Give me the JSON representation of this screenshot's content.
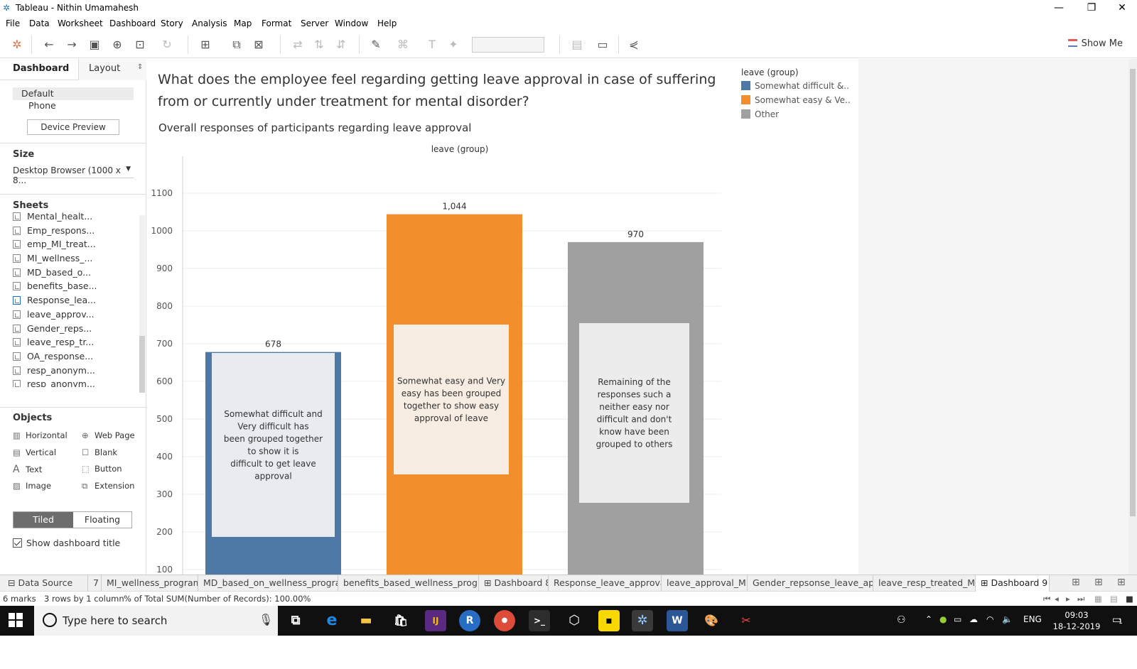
{
  "window": {
    "title": "Tableau - Nithin Umamahesh"
  },
  "menu": [
    "File",
    "Data",
    "Worksheet",
    "Dashboard",
    "Story",
    "Analysis",
    "Map",
    "Format",
    "Server",
    "Window",
    "Help"
  ],
  "toolbar": {
    "show_me": "Show Me"
  },
  "left_pane": {
    "tab_dashboard": "Dashboard",
    "tab_layout": "Layout",
    "device_default": "Default",
    "device_phone": "Phone",
    "device_preview_button": "Device Preview",
    "size_title": "Size",
    "size_value": "Desktop Browser (1000 x 8...",
    "sheets_title": "Sheets",
    "sheets": [
      "Mental_healt...",
      "Emp_respons...",
      "emp_MI_treat...",
      "MI_wellness_...",
      "MD_based_o...",
      "benefits_base...",
      "Response_lea...",
      "leave_approv...",
      "Gender_reps...",
      "leave_resp_tr...",
      "OA_response...",
      "resp_anonym...",
      "resp_anonym..."
    ],
    "objects_title": "Objects",
    "objects": {
      "horizontal": "Horizontal",
      "web_page": "Web Page",
      "vertical": "Vertical",
      "blank": "Blank",
      "text": "Text",
      "button": "Button",
      "image": "Image",
      "extension": "Extension"
    },
    "tiled": "Tiled",
    "floating": "Floating",
    "show_dashboard_title": "Show dashboard title"
  },
  "dashboard": {
    "title": "What does the employee feel regarding getting leave approval in case of suffering from or currently under treatment for mental disorder?",
    "subtitle": "Overall responses of participants regarding leave approval"
  },
  "legend": {
    "title": "leave (group)",
    "items": [
      {
        "label": "Somewhat difficult &..",
        "color": "#4e79a7"
      },
      {
        "label": "Somewhat easy & Ve..",
        "color": "#f28e2b"
      },
      {
        "label": "Other",
        "color": "#a0a0a0"
      }
    ]
  },
  "chart_data": {
    "type": "bar",
    "header": "leave (group)",
    "categories": [
      "Somewhat difficult &..",
      "Somewhat easy & Ve..",
      "Other"
    ],
    "values": [
      678,
      1044,
      970
    ],
    "value_labels": [
      "678",
      "1,044",
      "970"
    ],
    "colors": [
      "#4e79a7",
      "#f28e2b",
      "#a0a0a0"
    ],
    "yticks": [
      100,
      200,
      300,
      400,
      500,
      600,
      700,
      800,
      900,
      1000,
      1100
    ],
    "ylim": [
      0,
      1150
    ],
    "grid": true,
    "annotations": [
      "Somewhat difficult and Very difficult has been grouped together to show it is difficult to get leave approval",
      "Somewhat easy and Very easy has been grouped together to show easy approval of leave",
      "Remaining of the responses such a neither easy nor difficult and don't know have been grouped to others"
    ]
  },
  "sheet_tabs": [
    "Data Source",
    "7",
    "MI_wellness_program",
    "MD_based_on_wellness_program",
    "benefits_based_wellness_progr...",
    "Dashboard 8",
    "Response_leave_approval",
    "leave_approval_MD",
    "Gender_repsonse_leave_appr",
    "leave_resp_treated_MI",
    "Dashboard 9"
  ],
  "status": {
    "marks": "6 marks",
    "rows": "3 rows by 1 column",
    "pct": "% of Total SUM(Number of Records): 100.00%"
  },
  "taskbar": {
    "search_placeholder": "Type here to search",
    "lang": "ENG",
    "time": "09:03",
    "date": "18-12-2019",
    "notifications": "1"
  }
}
